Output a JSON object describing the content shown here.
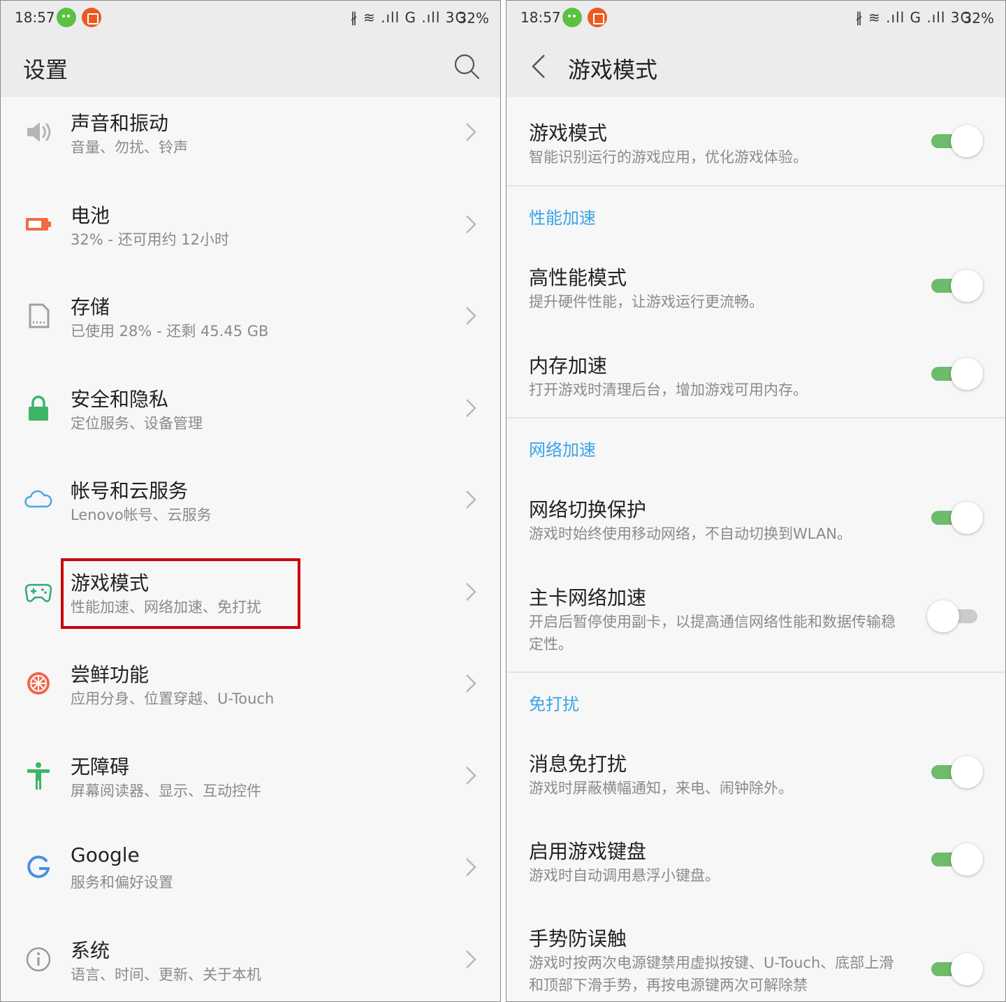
{
  "status_bar": {
    "time": "18:57",
    "signals": "∦ ≋ .ıll G .ıll 3G",
    "battery": "32%"
  },
  "settings": {
    "title": "设置",
    "items": [
      {
        "title": "声音和振动",
        "subtitle": "音量、勿扰、铃声",
        "icon": "speaker-icon"
      },
      {
        "title": "电池",
        "subtitle": "32% - 还可用约 12小时",
        "icon": "battery-icon"
      },
      {
        "title": "存储",
        "subtitle": "已使用 28% - 还剩 45.45 GB",
        "icon": "sd-card-icon"
      },
      {
        "title": "安全和隐私",
        "subtitle": "定位服务、设备管理",
        "icon": "lock-icon"
      },
      {
        "title": "帐号和云服务",
        "subtitle": "Lenovo帐号、云服务",
        "icon": "cloud-icon"
      },
      {
        "title": "游戏模式",
        "subtitle": "性能加速、网络加速、免打扰",
        "icon": "gamepad-icon"
      },
      {
        "title": "尝鲜功能",
        "subtitle": "应用分身、位置穿越、U-Touch",
        "icon": "orange-slice-icon"
      },
      {
        "title": "无障碍",
        "subtitle": "屏幕阅读器、显示、互动控件",
        "icon": "accessibility-icon"
      },
      {
        "title": "Google",
        "subtitle": "服务和偏好设置",
        "icon": "google-icon"
      },
      {
        "title": "系统",
        "subtitle": "语言、时间、更新、关于本机",
        "icon": "info-icon"
      }
    ]
  },
  "game_mode": {
    "title": "游戏模式",
    "master": {
      "title": "游戏模式",
      "desc": "智能识别运行的游戏应用，优化游戏体验。",
      "on": true
    },
    "sections": [
      {
        "header": "性能加速",
        "rows": [
          {
            "title": "高性能模式",
            "desc": "提升硬件性能，让游戏运行更流畅。",
            "on": true
          },
          {
            "title": "内存加速",
            "desc": "打开游戏时清理后台，增加游戏可用内存。",
            "on": true
          }
        ]
      },
      {
        "header": "网络加速",
        "rows": [
          {
            "title": "网络切换保护",
            "desc": "游戏时始终使用移动网络，不自动切换到WLAN。",
            "on": true
          },
          {
            "title": "主卡网络加速",
            "desc": "开启后暂停使用副卡，以提高通信网络性能和数据传输稳定性。",
            "on": false
          }
        ]
      },
      {
        "header": "免打扰",
        "rows": [
          {
            "title": "消息免打扰",
            "desc": "游戏时屏蔽横幅通知，来电、闹钟除外。",
            "on": true
          },
          {
            "title": "启用游戏键盘",
            "desc": "游戏时自动调用悬浮小键盘。",
            "on": true
          },
          {
            "title": "手势防误触",
            "desc": "游戏时按两次电源键禁用虚拟按键、U-Touch、底部上滑和顶部下滑手势，再按电源键两次可解除禁",
            "on": true
          }
        ]
      }
    ]
  },
  "colors": {
    "accent_blue": "#3aa3e6",
    "toggle_on": "#6dbb6b",
    "highlight_red": "#c8000a"
  }
}
